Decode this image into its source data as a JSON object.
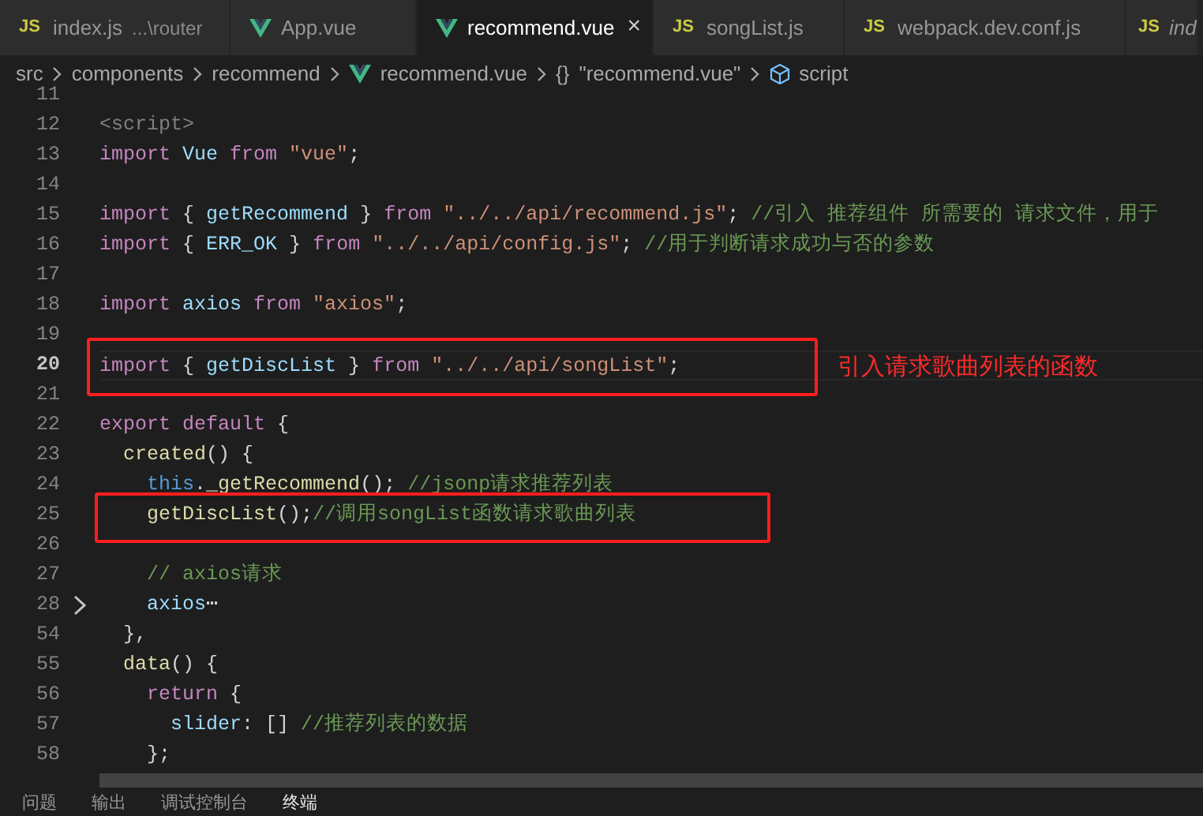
{
  "tabs": [
    {
      "kind": "js",
      "badge": "JS",
      "label": "index.js",
      "description": "...\\router",
      "selected": false,
      "preview": false
    },
    {
      "kind": "vue",
      "label": "App.vue",
      "selected": false,
      "preview": false
    },
    {
      "kind": "vue",
      "label": "recommend.vue",
      "selected": true,
      "preview": false,
      "close": "×"
    },
    {
      "kind": "js",
      "badge": "JS",
      "label": "songList.js",
      "selected": false,
      "preview": false
    },
    {
      "kind": "js",
      "badge": "JS",
      "label": "webpack.dev.conf.js",
      "selected": false,
      "preview": false
    },
    {
      "kind": "js",
      "badge": "JS",
      "label": "ind",
      "selected": false,
      "preview": true
    }
  ],
  "breadcrumb": [
    {
      "kind": "folder",
      "label": "src"
    },
    {
      "kind": "folder",
      "label": "components"
    },
    {
      "kind": "folder",
      "label": "recommend"
    },
    {
      "kind": "vue",
      "label": "recommend.vue"
    },
    {
      "kind": "object",
      "icon": "{}",
      "label": "\"recommend.vue\""
    },
    {
      "kind": "module",
      "label": "script"
    }
  ],
  "code_lines": [
    {
      "number": "11",
      "current": false,
      "fold": false,
      "highlighted": false
    },
    {
      "number": "12",
      "current": false,
      "fold": false,
      "highlighted": false,
      "tokens": [
        {
          "text": "<script>",
          "kind": "tag"
        }
      ]
    },
    {
      "number": "13",
      "current": false,
      "fold": false,
      "highlighted": false,
      "tokens": [
        {
          "text": "import",
          "kind": "keyword"
        },
        {
          "text": " Vue ",
          "kind": "var"
        },
        {
          "text": "from",
          "kind": "keyword"
        },
        {
          "text": " \"vue\"",
          "kind": "string"
        },
        {
          "text": ";",
          "kind": "plain"
        }
      ]
    },
    {
      "number": "14",
      "current": false,
      "fold": false,
      "highlighted": false
    },
    {
      "number": "15",
      "current": false,
      "fold": false,
      "highlighted": false,
      "tokens": [
        {
          "text": "import",
          "kind": "keyword"
        },
        {
          "text": " { ",
          "kind": "plain"
        },
        {
          "text": "getRecommend",
          "kind": "var"
        },
        {
          "text": " } ",
          "kind": "plain"
        },
        {
          "text": "from",
          "kind": "keyword"
        },
        {
          "text": " \"../../api/recommend.js\"",
          "kind": "string"
        },
        {
          "text": "; ",
          "kind": "plain"
        },
        {
          "text": "//引入 推荐组件 所需要的 请求文件，用于",
          "kind": "comment"
        }
      ]
    },
    {
      "number": "16",
      "current": false,
      "fold": false,
      "highlighted": false,
      "tokens": [
        {
          "text": "import",
          "kind": "keyword"
        },
        {
          "text": " { ",
          "kind": "plain"
        },
        {
          "text": "ERR_OK",
          "kind": "var"
        },
        {
          "text": " } ",
          "kind": "plain"
        },
        {
          "text": "from",
          "kind": "keyword"
        },
        {
          "text": " \"../../api/config.js\"",
          "kind": "string"
        },
        {
          "text": "; ",
          "kind": "plain"
        },
        {
          "text": "//用于判断请求成功与否的参数",
          "kind": "comment"
        }
      ]
    },
    {
      "number": "17",
      "current": false,
      "fold": false,
      "highlighted": false
    },
    {
      "number": "18",
      "current": false,
      "fold": false,
      "highlighted": false,
      "tokens": [
        {
          "text": "import",
          "kind": "keyword"
        },
        {
          "text": " axios ",
          "kind": "var"
        },
        {
          "text": "from",
          "kind": "keyword"
        },
        {
          "text": " \"axios\"",
          "kind": "string"
        },
        {
          "text": ";",
          "kind": "plain"
        }
      ]
    },
    {
      "number": "19",
      "current": false,
      "fold": false,
      "highlighted": false
    },
    {
      "number": "20",
      "current": true,
      "fold": false,
      "highlighted": true,
      "note": "引入请求歌曲列表的函数",
      "tokens": [
        {
          "text": "import",
          "kind": "keyword"
        },
        {
          "text": " { ",
          "kind": "plain"
        },
        {
          "text": "getDiscList",
          "kind": "var"
        },
        {
          "text": " } ",
          "kind": "plain"
        },
        {
          "text": "from",
          "kind": "keyword"
        },
        {
          "text": " \"../../api/songList\"",
          "kind": "string"
        },
        {
          "text": ";",
          "kind": "plain"
        }
      ]
    },
    {
      "number": "21",
      "current": false,
      "fold": false,
      "highlighted": false
    },
    {
      "number": "22",
      "current": false,
      "fold": false,
      "highlighted": false,
      "tokens": [
        {
          "text": "export",
          "kind": "keyword"
        },
        {
          "text": " default",
          "kind": "keyword"
        },
        {
          "text": " {",
          "kind": "plain"
        }
      ]
    },
    {
      "number": "23",
      "current": false,
      "fold": false,
      "highlighted": false,
      "tokens": [
        {
          "text": "  created",
          "kind": "func"
        },
        {
          "text": "() {",
          "kind": "plain"
        }
      ]
    },
    {
      "number": "24",
      "current": false,
      "fold": false,
      "highlighted": false,
      "tokens": [
        {
          "text": "    this",
          "kind": "this"
        },
        {
          "text": ".",
          "kind": "plain"
        },
        {
          "text": "_getRecommend",
          "kind": "func"
        },
        {
          "text": "(); ",
          "kind": "plain"
        },
        {
          "text": "//jsonp请求推荐列表",
          "kind": "comment"
        }
      ]
    },
    {
      "number": "25",
      "current": false,
      "fold": false,
      "highlighted": true,
      "tokens": [
        {
          "text": "    getDiscList",
          "kind": "func"
        },
        {
          "text": "();",
          "kind": "plain"
        },
        {
          "text": "//调用songList函数请求歌曲列表",
          "kind": "comment"
        }
      ]
    },
    {
      "number": "26",
      "current": false,
      "fold": false,
      "highlighted": false
    },
    {
      "number": "27",
      "current": false,
      "fold": false,
      "highlighted": false,
      "tokens": [
        {
          "text": "    // axios请求",
          "kind": "comment"
        }
      ]
    },
    {
      "number": "28",
      "current": false,
      "fold": true,
      "highlighted": false,
      "tokens": [
        {
          "text": "    axios",
          "kind": "var"
        },
        {
          "text": "⋯",
          "kind": "plain"
        }
      ]
    },
    {
      "number": "54",
      "current": false,
      "fold": false,
      "highlighted": false,
      "tokens": [
        {
          "text": "  },",
          "kind": "plain"
        }
      ]
    },
    {
      "number": "55",
      "current": false,
      "fold": false,
      "highlighted": false,
      "tokens": [
        {
          "text": "  data",
          "kind": "func"
        },
        {
          "text": "() {",
          "kind": "plain"
        }
      ]
    },
    {
      "number": "56",
      "current": false,
      "fold": false,
      "highlighted": false,
      "tokens": [
        {
          "text": "    return",
          "kind": "keyword"
        },
        {
          "text": " {",
          "kind": "plain"
        }
      ]
    },
    {
      "number": "57",
      "current": false,
      "fold": false,
      "highlighted": false,
      "tokens": [
        {
          "text": "      slider",
          "kind": "var"
        },
        {
          "text": ": [] ",
          "kind": "plain"
        },
        {
          "text": "//推荐列表的数据",
          "kind": "comment"
        }
      ]
    },
    {
      "number": "58",
      "current": false,
      "fold": false,
      "highlighted": false,
      "tokens": [
        {
          "text": "    };",
          "kind": "plain"
        }
      ]
    }
  ],
  "panel_tabs": [
    {
      "label": "问题",
      "selected": false
    },
    {
      "label": "输出",
      "selected": false
    },
    {
      "label": "调试控制台",
      "selected": false
    },
    {
      "label": "终端",
      "selected": true
    }
  ]
}
